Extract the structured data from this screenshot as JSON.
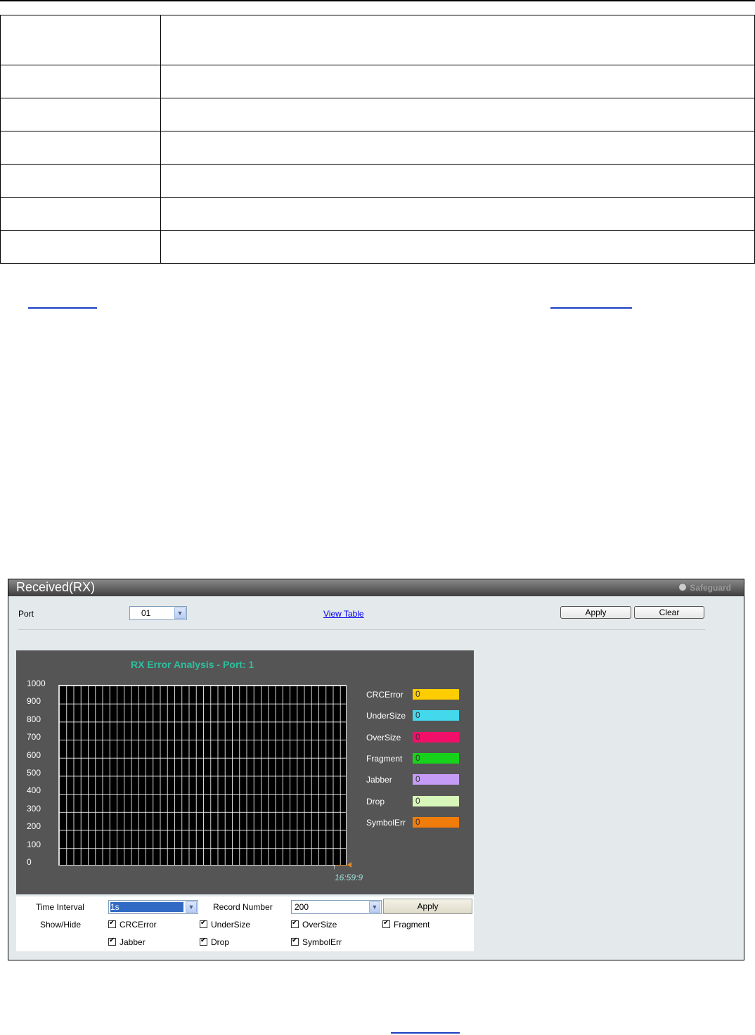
{
  "panel": {
    "title": "Received(RX)",
    "safeguard": "Safeguard",
    "port_label": "Port",
    "port_value": "01",
    "view_table": "View Table",
    "apply": "Apply",
    "clear": "Clear"
  },
  "chart_data": {
    "type": "line",
    "title": "RX Error Analysis - Port: 1",
    "ylim": [
      0,
      1000
    ],
    "y_ticks": [
      "1000",
      "900",
      "800",
      "700",
      "600",
      "500",
      "400",
      "300",
      "200",
      "100",
      "0"
    ],
    "x_label_last": "16:59:9",
    "series": [
      {
        "name": "CRCError",
        "value": "0",
        "color": "#ffcc00"
      },
      {
        "name": "UnderSize",
        "value": "0",
        "color": "#44d8ec"
      },
      {
        "name": "OverSize",
        "value": "0",
        "color": "#f0106a"
      },
      {
        "name": "Fragment",
        "value": "0",
        "color": "#17d21a"
      },
      {
        "name": "Jabber",
        "value": "0",
        "color": "#c59cf5"
      },
      {
        "name": "Drop",
        "value": "0",
        "color": "#d7f6b9"
      },
      {
        "name": "SymbolErr",
        "value": "0",
        "color": "#f07c0c"
      }
    ]
  },
  "controls": {
    "time_interval_label": "Time Interval",
    "time_interval_value": "1s",
    "record_number_label": "Record Number",
    "record_number_value": "200",
    "apply": "Apply",
    "show_hide_label": "Show/Hide",
    "checkboxes": [
      "CRCError",
      "UnderSize",
      "OverSize",
      "Fragment",
      "Jabber",
      "Drop",
      "SymbolErr"
    ]
  }
}
